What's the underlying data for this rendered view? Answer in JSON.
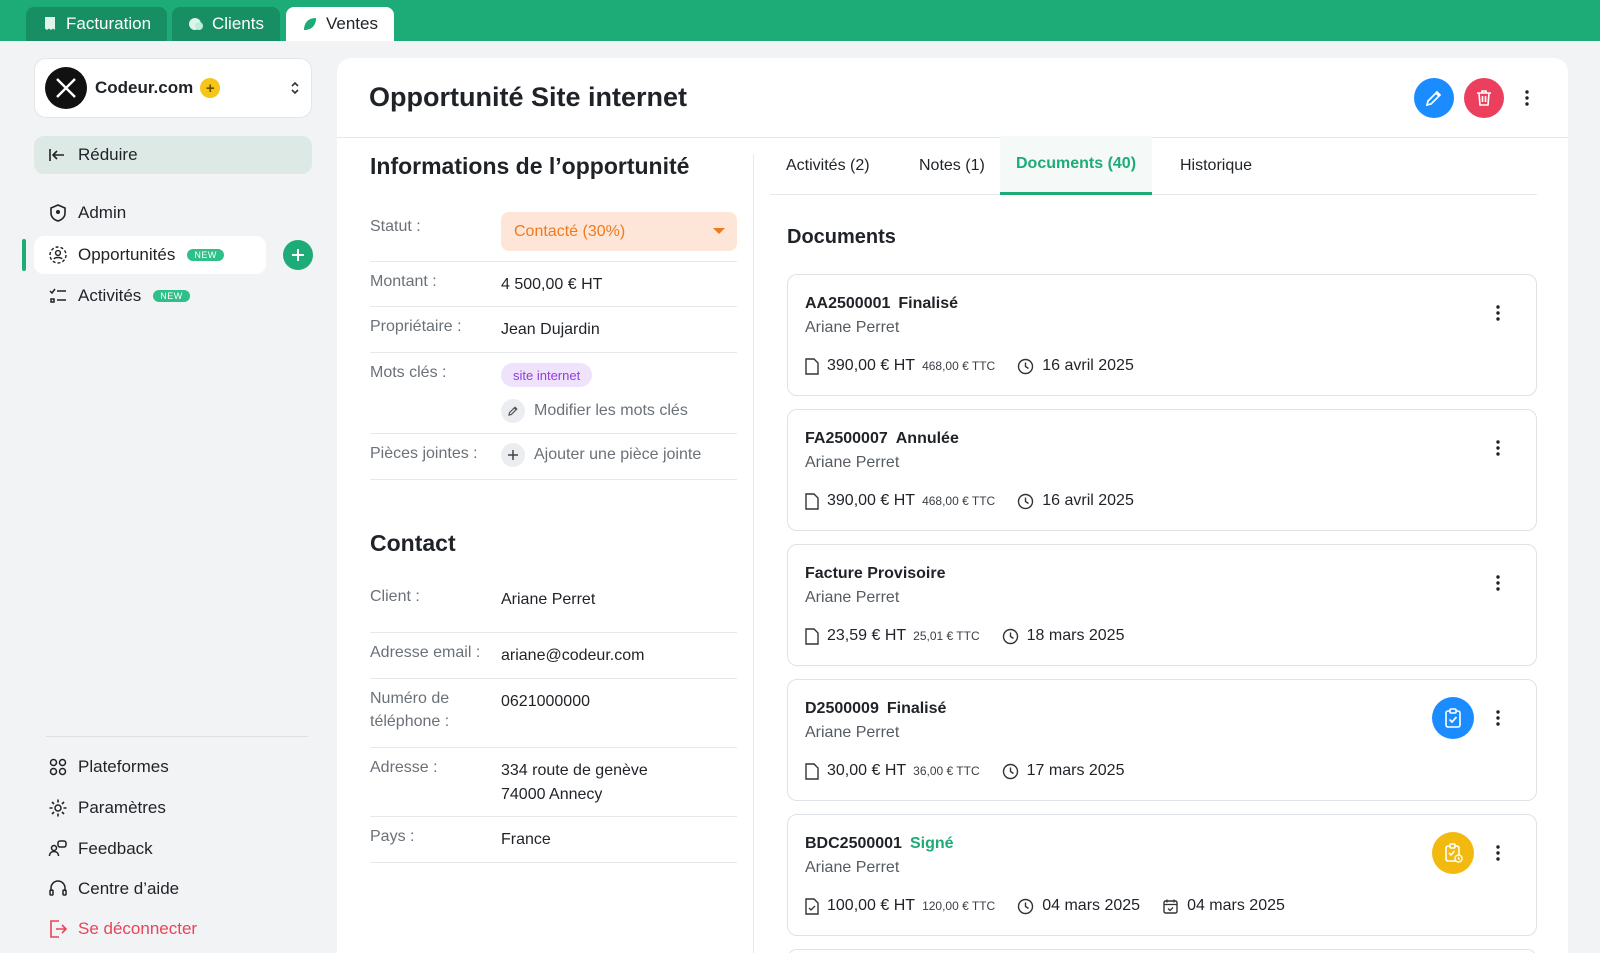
{
  "app_tabs": [
    {
      "label": "Facturation",
      "icon": "invoice-icon",
      "active": false
    },
    {
      "label": "Clients",
      "icon": "clients-icon",
      "active": false
    },
    {
      "label": "Ventes",
      "icon": "sales-leaf-icon",
      "active": true
    }
  ],
  "sidebar": {
    "org_name": "Codeur.com",
    "org_badge": "+",
    "collapse_label": "Réduire",
    "new_badge": "NEW",
    "items": [
      {
        "label": "Admin",
        "icon": "shield-icon"
      },
      {
        "label": "Opportunités",
        "icon": "opportunities-icon",
        "badge": "NEW",
        "active": true
      },
      {
        "label": "Activités",
        "icon": "activities-icon",
        "badge": "NEW"
      }
    ],
    "bottom_items": [
      {
        "label": "Plateformes",
        "icon": "platforms-icon"
      },
      {
        "label": "Paramètres",
        "icon": "gear-icon"
      },
      {
        "label": "Feedback",
        "icon": "feedback-icon"
      },
      {
        "label": "Centre d’aide",
        "icon": "headset-icon"
      },
      {
        "label": "Se déconnecter",
        "icon": "logout-icon"
      }
    ]
  },
  "page": {
    "title": "Opportunité Site internet"
  },
  "info": {
    "title": "Informations de l’opportunité",
    "status_label": "Statut :",
    "status_value": "Contacté (30%)",
    "amount_label": "Montant :",
    "amount_value": "4 500,00 € HT",
    "owner_label": "Propriétaire :",
    "owner_value": "Jean Dujardin",
    "keywords_label": "Mots clés :",
    "keyword_tag": "site internet",
    "edit_keywords": "Modifier les mots clés",
    "attachments_label": "Pièces jointes :",
    "add_attachment": "Ajouter une pièce jointe"
  },
  "contact": {
    "title": "Contact",
    "client_label": "Client :",
    "client_value": "Ariane Perret",
    "email_label": "Adresse email :",
    "email_value": "ariane@codeur.com",
    "phone_label_1": "Numéro de",
    "phone_label_2": "téléphone :",
    "phone_value": "0621000000",
    "address_label": "Adresse :",
    "address_line1": "334 route de genève",
    "address_line2": "74000 Annecy",
    "country_label": "Pays :",
    "country_value": "France"
  },
  "doc_tabs": [
    {
      "label": "Activités (2)"
    },
    {
      "label": "Notes (1)"
    },
    {
      "label": "Documents (40)",
      "active": true
    },
    {
      "label": "Historique"
    }
  ],
  "documents": {
    "title": "Documents",
    "items": [
      {
        "ref": "AA2500001",
        "state": "Finalisé",
        "client": "Ariane Perret",
        "ht": "390,00 € HT",
        "ttc": "468,00 € TTC",
        "date": "16 avril 2025"
      },
      {
        "ref": "FA2500007",
        "state": "Annulée",
        "client": "Ariane Perret",
        "ht": "390,00 € HT",
        "ttc": "468,00 € TTC",
        "date": "16 avril 2025"
      },
      {
        "ref": "Facture Provisoire",
        "state": "",
        "client": "Ariane Perret",
        "ht": "23,59 € HT",
        "ttc": "25,01 € TTC",
        "date": "18 mars 2025"
      },
      {
        "ref": "D2500009",
        "state": "Finalisé",
        "client": "Ariane Perret",
        "ht": "30,00 € HT",
        "ttc": "36,00 € TTC",
        "date": "17 mars 2025",
        "status_icon": "clipboard-check-icon"
      },
      {
        "ref": "BDC2500001",
        "state": "Signé",
        "client": "Ariane Perret",
        "ht": "100,00 € HT",
        "ttc": "120,00 € TTC",
        "date": "04 mars 2025",
        "date2": "04 mars 2025",
        "status_icon": "clipboard-pending-icon"
      }
    ]
  },
  "colors": {
    "brand": "#1dab77",
    "edit": "#1a8cff",
    "delete": "#ec3f5d",
    "status_orange": "#f07a1c",
    "keyword_purple": "#8e3fd8",
    "logout_red": "#e8445a"
  }
}
